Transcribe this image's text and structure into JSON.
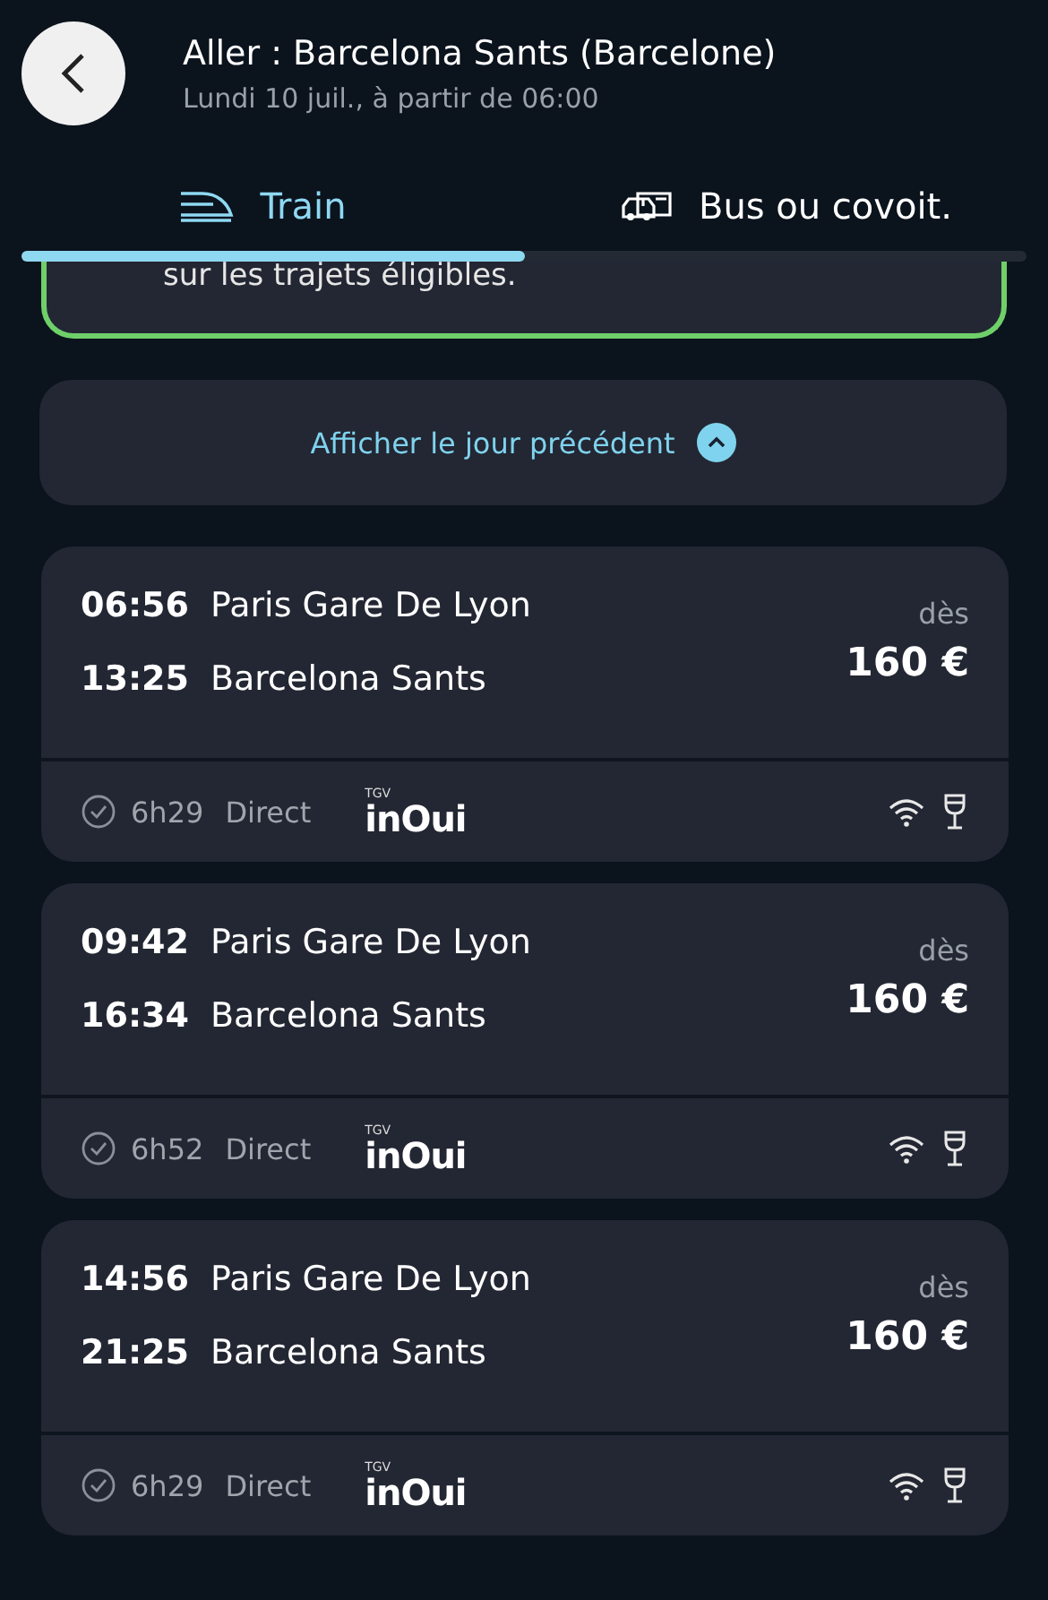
{
  "header": {
    "title": "Aller : Barcelona Sants (Barcelone)",
    "subtitle": "Lundi 10 juil., à partir de 06:00"
  },
  "tabs": [
    {
      "label": "Train",
      "kind": "train",
      "selected": true
    },
    {
      "label": "Bus ou covoit.",
      "kind": "bus",
      "selected": false
    }
  ],
  "notice": {
    "text": "sur les trajets éligibles."
  },
  "previous_day": {
    "label": "Afficher le jour précédent"
  },
  "journeys": [
    {
      "departure_time": "06:56",
      "departure_station": "Paris Gare De Lyon",
      "arrival_time": "13:25",
      "arrival_station": "Barcelona Sants",
      "price_prefix": "dès",
      "price": "160 €",
      "duration": "6h29",
      "type": "Direct",
      "operator_small": "TGV",
      "operator": "inOui"
    },
    {
      "departure_time": "09:42",
      "departure_station": "Paris Gare De Lyon",
      "arrival_time": "16:34",
      "arrival_station": "Barcelona Sants",
      "price_prefix": "dès",
      "price": "160 €",
      "duration": "6h52",
      "type": "Direct",
      "operator_small": "TGV",
      "operator": "inOui"
    },
    {
      "departure_time": "14:56",
      "departure_station": "Paris Gare De Lyon",
      "arrival_time": "21:25",
      "arrival_station": "Barcelona Sants",
      "price_prefix": "dès",
      "price": "160 €",
      "duration": "6h29",
      "type": "Direct",
      "operator_small": "TGV",
      "operator": "inOui"
    }
  ]
}
